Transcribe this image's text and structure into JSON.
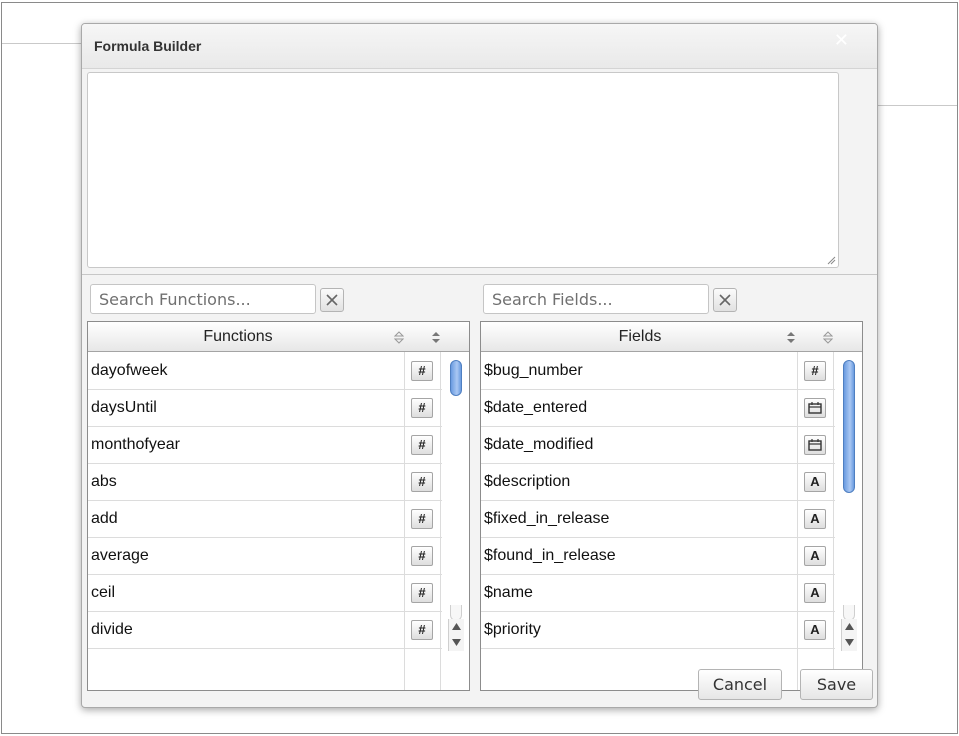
{
  "dialog": {
    "title": "Formula Builder",
    "close_symbol": "✕"
  },
  "formula": {
    "value": ""
  },
  "functions_search": {
    "placeholder": "Search Functions..."
  },
  "fields_search": {
    "placeholder": "Search Fields..."
  },
  "functions_list": {
    "header": "Functions",
    "items": [
      {
        "label": "dayofweek",
        "type": "#"
      },
      {
        "label": "daysUntil",
        "type": "#"
      },
      {
        "label": "monthofyear",
        "type": "#"
      },
      {
        "label": "abs",
        "type": "#"
      },
      {
        "label": "add",
        "type": "#"
      },
      {
        "label": "average",
        "type": "#"
      },
      {
        "label": "ceil",
        "type": "#"
      },
      {
        "label": "divide",
        "type": "#"
      }
    ]
  },
  "fields_list": {
    "header": "Fields",
    "items": [
      {
        "label": "$bug_number",
        "type": "#"
      },
      {
        "label": "$date_entered",
        "type": "date"
      },
      {
        "label": "$date_modified",
        "type": "date"
      },
      {
        "label": "$description",
        "type": "A"
      },
      {
        "label": "$fixed_in_release",
        "type": "A"
      },
      {
        "label": "$found_in_release",
        "type": "A"
      },
      {
        "label": "$name",
        "type": "A"
      },
      {
        "label": "$priority",
        "type": "A"
      }
    ]
  },
  "buttons": {
    "cancel": "Cancel",
    "save": "Save"
  },
  "colors": {
    "scroll_thumb": "#6a9be0",
    "dialog_bg": "#f3f3f3",
    "border": "#8c8c8c"
  }
}
